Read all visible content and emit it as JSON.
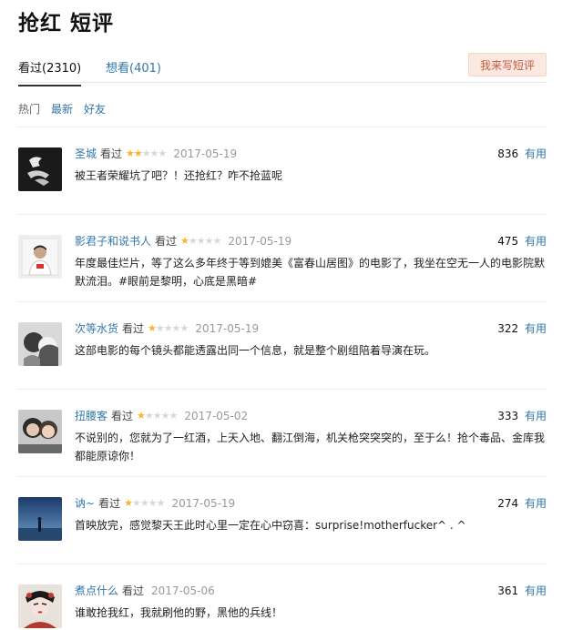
{
  "header": {
    "title": "抢红 短评"
  },
  "tabs": [
    {
      "label": "看过(2310)"
    },
    {
      "label": "想看(401)"
    }
  ],
  "write_button": "我来写短评",
  "filters": [
    {
      "label": "热门"
    },
    {
      "label": "最新"
    },
    {
      "label": "好友"
    }
  ],
  "reviews": [
    {
      "user": "圣城",
      "watched": "看过",
      "rating": 2,
      "date": "2017-05-19",
      "votes": "836",
      "useful_label": "有用",
      "text": "被王者荣耀坑了吧？！还抢红？咋不抢蓝呢"
    },
    {
      "user": "影君子和说书人",
      "watched": "看过",
      "rating": 1,
      "date": "2017-05-19",
      "votes": "475",
      "useful_label": "有用",
      "text": "年度最佳烂片，等了这么多年终于等到媲美《富春山居图》的电影了，我坐在空无一人的电影院默默流泪。#眼前是黎明，心底是黑暗#"
    },
    {
      "user": "次等水货",
      "watched": "看过",
      "rating": 1,
      "date": "2017-05-19",
      "votes": "322",
      "useful_label": "有用",
      "text": "这部电影的每个镜头都能透露出同一个信息，就是整个剧组陪着导演在玩。"
    },
    {
      "user": "扭腰客",
      "watched": "看过",
      "rating": 1,
      "date": "2017-05-02",
      "votes": "333",
      "useful_label": "有用",
      "text": "不说别的，您就为了一红酒，上天入地、翻江倒海，机关枪突突突的，至于么！抢个毒品、金库我都能原谅你！"
    },
    {
      "user": "讷~",
      "watched": "看过",
      "rating": 1,
      "date": "2017-05-19",
      "votes": "274",
      "useful_label": "有用",
      "text": "首映放完，感觉黎天王此时心里一定在心中窃喜：surprise!motherfucker^ . ^"
    },
    {
      "user": "煮点什么",
      "watched": "看过",
      "rating": 0,
      "date": "2017-05-06",
      "votes": "361",
      "useful_label": "有用",
      "text": "谁敢抢我红，我就刷他的野，黑他的兵线！"
    }
  ]
}
